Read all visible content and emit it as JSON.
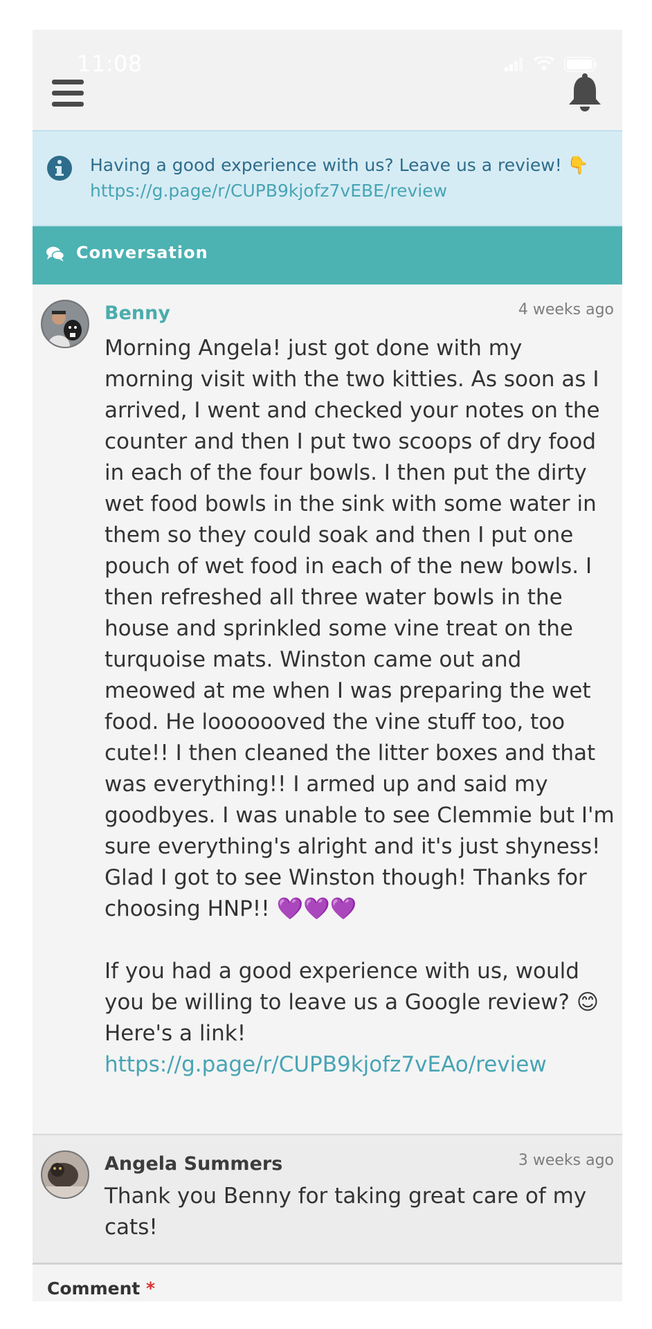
{
  "status_bar": {
    "time": "11:08"
  },
  "header": {
    "menu_icon": "hamburger-menu-icon",
    "bell_icon": "bell-icon"
  },
  "alert": {
    "icon": "info-icon",
    "text": "Having a good experience with us? Leave us a review! 👇",
    "link": "https://g.page/r/CUPB9kjofz7vEBE/review"
  },
  "conversation": {
    "title": "Conversation",
    "icon": "comments-icon",
    "messages": [
      {
        "author": "Benny",
        "time": "4 weeks ago",
        "body": "Morning Angela! just got done with my morning visit with the two kitties. As soon as I arrived, I went and checked your notes on the counter and then I put two scoops of dry food in each of the four bowls. I then put the dirty wet food bowls in the sink with some water in them so they could soak and then I put one pouch of wet food in each of the new bowls. I then refreshed all three water bowls in the house and sprinkled some vine treat on the turquoise mats. Winston came out and meowed at me when I was preparing the wet food. He looooooved the vine stuff too, too cute!! I then cleaned the litter boxes and that was everything!! I armed up and said my goodbyes. I was unable to see Clemmie but I'm sure everything's alright and it's just shyness! Glad I got to see Winston though! Thanks for choosing HNP!! 💜💜💜\n\nIf you had a good experience with us, would you be willing to leave us a Google review? 😊 Here's a link!",
        "link": "https://g.page/r/CUPB9kjofz7vEAo/review"
      },
      {
        "author": "Angela Summers",
        "time": "3 weeks ago",
        "body": "Thank you Benny for taking great care of my cats!"
      }
    ]
  },
  "comment": {
    "label": "Comment",
    "required_mark": "*"
  },
  "colors": {
    "accent_teal": "#4cb2b2",
    "link": "#47a4b4",
    "alert_bg": "#d6ecf4",
    "required": "#d9302f"
  }
}
